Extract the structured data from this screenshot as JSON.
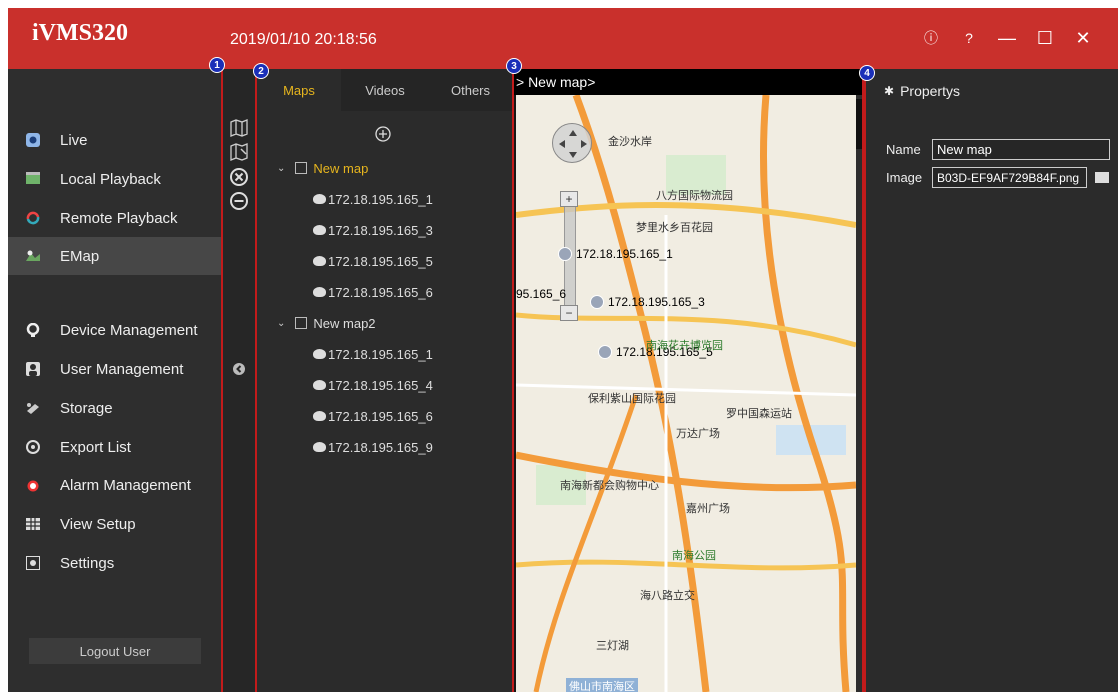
{
  "app": {
    "logo": "iVMS320",
    "datetime": "2019/01/10 20:18:56"
  },
  "window_buttons": [
    "ⓘ",
    "?",
    "—",
    "☐",
    "✕"
  ],
  "nav": {
    "items": [
      {
        "label": "Live",
        "icon": "live-icon"
      },
      {
        "label": "Local Playback",
        "icon": "local-playback-icon"
      },
      {
        "label": "Remote Playback",
        "icon": "remote-playback-icon"
      },
      {
        "label": "EMap",
        "icon": "emap-icon",
        "active": true
      },
      {
        "label": "Device Management",
        "icon": "device-management-icon"
      },
      {
        "label": "User Management",
        "icon": "user-management-icon"
      },
      {
        "label": "Storage",
        "icon": "storage-icon"
      },
      {
        "label": "Export List",
        "icon": "export-list-icon"
      },
      {
        "label": "Alarm Management",
        "icon": "alarm-icon"
      },
      {
        "label": "View Setup",
        "icon": "view-setup-icon"
      },
      {
        "label": "Settings",
        "icon": "settings-icon"
      }
    ],
    "logout_label": "Logout User"
  },
  "badges": [
    "1",
    "2",
    "3",
    "4"
  ],
  "tree": {
    "tabs": [
      {
        "label": "Maps",
        "active": true
      },
      {
        "label": "Videos"
      },
      {
        "label": "Others"
      }
    ],
    "maps": [
      {
        "name": "New map",
        "selected": true,
        "devices": [
          "172.18.195.165_1",
          "172.18.195.165_3",
          "172.18.195.165_5",
          "172.18.195.165_6"
        ]
      },
      {
        "name": "New map2",
        "devices": [
          "172.18.195.165_1",
          "172.18.195.165_4",
          "172.18.195.165_6",
          "172.18.195.165_9"
        ]
      }
    ]
  },
  "map": {
    "header": "> New map>",
    "markers": [
      "172.18.195.165_1",
      "95.165_6",
      "172.18.195.165_3",
      "172.18.195.165_5"
    ],
    "labels": [
      "金沙水岸",
      "八方国际物流园",
      "梦里水乡百花园",
      "南海花卉博览园",
      "保利紫山国际花园",
      "罗中国森运站",
      "万达广场",
      "南海新都会购物中心",
      "嘉州广场",
      "南海公园",
      "海八路立交",
      "三灯湖",
      "佛山市南海区"
    ]
  },
  "properties": {
    "title": "Propertys",
    "name_label": "Name",
    "name_value": "New map",
    "image_label": "Image",
    "image_value": "B03D-EF9AF729B84F.png"
  },
  "colors": {
    "titlebar": "#c9302c",
    "accent_yellow": "#e6b51e",
    "badge_blue": "#1a2fb8",
    "frame_red": "#c21b1b"
  }
}
